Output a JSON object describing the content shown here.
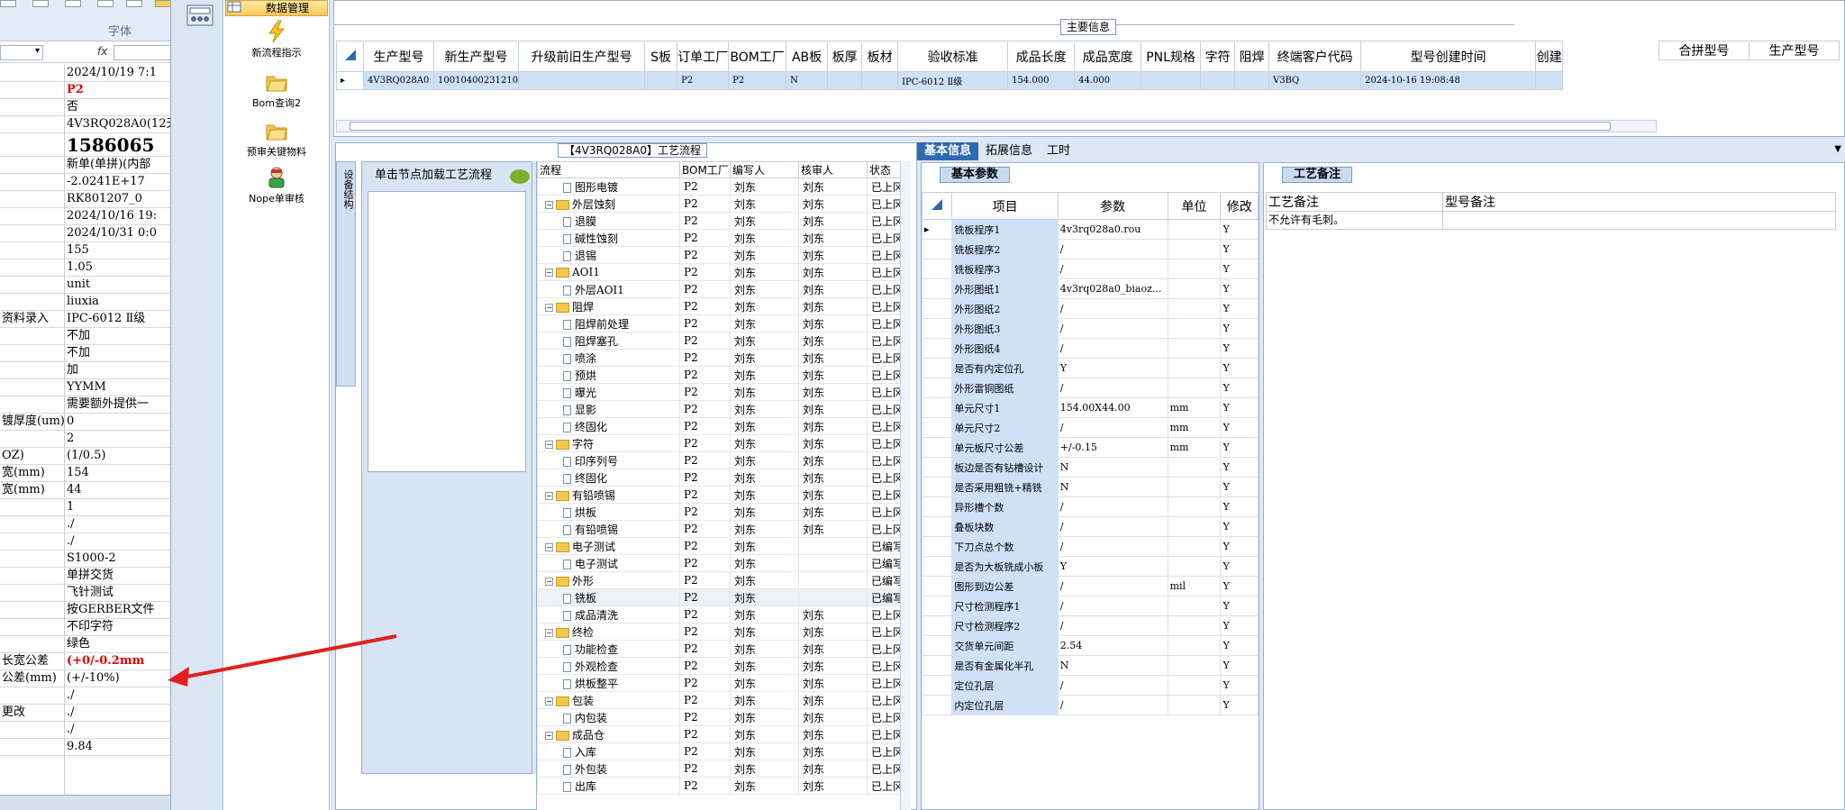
{
  "excel": {
    "ribbon_group": "字体",
    "formula_fx": "fx",
    "col_a": [
      "",
      "",
      "",
      "",
      "",
      "",
      "",
      "",
      "",
      "",
      "",
      "",
      "",
      "",
      "资料录入",
      "",
      "",
      "",
      "",
      "",
      "镀厚度(um)",
      "",
      "OZ)",
      "宽(mm)",
      "宽(mm)",
      "",
      "",
      "",
      "",
      "",
      "",
      "",
      "",
      "",
      "长宽公差",
      "公差(mm)",
      "",
      "更改",
      "",
      ""
    ],
    "col_b": [
      "2024/10/19 7:1",
      "P2",
      "否",
      "4V3RQ028A0(12天",
      "1586065",
      "新单(单拼)(内部",
      "-2.0241E+17",
      "RK801207_0",
      "2024/10/16 19:",
      "2024/10/31 0:0",
      "155",
      "1.05",
      "unit",
      "liuxia",
      "IPC-6012 Ⅱ级",
      "不加",
      "不加",
      "加",
      "YYMM",
      "需要额外提供一",
      "0",
      "2",
      "(1/0.5)",
      "154",
      "44",
      "1",
      "./",
      "./",
      "S1000-2",
      "单拼交货",
      "飞针测试",
      "按GERBER文件",
      "不印字符",
      "绿色",
      "(+0/-0.2mm",
      "(+/-10%)",
      "./",
      "./",
      "./",
      "9.84"
    ]
  },
  "nav": {
    "header": "数据管理",
    "items": [
      {
        "label": "新流程指示",
        "icon": "lightning-icon"
      },
      {
        "label": "Bom查询2",
        "icon": "folder-icon"
      },
      {
        "label": "预审关键物料",
        "icon": "folder-icon"
      },
      {
        "label": "Nope单审核",
        "icon": "user-icon"
      }
    ]
  },
  "main_info": {
    "caption": "主要信息",
    "columns": [
      "生产型号",
      "新生产型号",
      "升级前旧生产型号",
      "S板",
      "订单工厂",
      "BOM工厂",
      "AB板",
      "板厚",
      "板材",
      "验收标准",
      "成品长度",
      "成品宽度",
      "PNL规格",
      "字符",
      "阻焊",
      "终端客户代码",
      "型号创建时间",
      "创建"
    ],
    "row": [
      "4V3RQ028A0",
      "10010400231210",
      "",
      "",
      "P2",
      "P2",
      "N",
      "",
      "",
      "IPC-6012 Ⅱ级",
      "154.000",
      "44.000",
      "",
      "",
      "",
      "V3BQ",
      "2024-10-16 19:08:48",
      ""
    ],
    "right_columns": [
      "合拼型号",
      "生产型号"
    ]
  },
  "process": {
    "title": "【4V3RQ028A0】工艺流程",
    "side_tab": "设备结构",
    "click_label": "单击节点加载工艺流程",
    "columns": [
      "流程",
      "BOM工厂",
      "编写人",
      "核审人",
      "状态"
    ],
    "rows": [
      {
        "name": "图形电镀",
        "level": 1,
        "f": "P2",
        "w": "刘东",
        "r": "刘东",
        "s": "已上冈",
        "folder": false
      },
      {
        "name": "外层蚀刻",
        "level": 0,
        "f": "P2",
        "w": "刘东",
        "r": "刘东",
        "s": "已上冈",
        "folder": true
      },
      {
        "name": "退膜",
        "level": 1,
        "f": "P2",
        "w": "刘东",
        "r": "刘东",
        "s": "已上冈",
        "folder": false
      },
      {
        "name": "碱性蚀刻",
        "level": 1,
        "f": "P2",
        "w": "刘东",
        "r": "刘东",
        "s": "已上冈",
        "folder": false
      },
      {
        "name": "退锡",
        "level": 1,
        "f": "P2",
        "w": "刘东",
        "r": "刘东",
        "s": "已上冈",
        "folder": false
      },
      {
        "name": "AOI1",
        "level": 0,
        "f": "P2",
        "w": "刘东",
        "r": "刘东",
        "s": "已上冈",
        "folder": true
      },
      {
        "name": "外层AOI1",
        "level": 1,
        "f": "P2",
        "w": "刘东",
        "r": "刘东",
        "s": "已上冈",
        "folder": false
      },
      {
        "name": "阻焊",
        "level": 0,
        "f": "P2",
        "w": "刘东",
        "r": "刘东",
        "s": "已上冈",
        "folder": true
      },
      {
        "name": "阻焊前处理",
        "level": 1,
        "f": "P2",
        "w": "刘东",
        "r": "刘东",
        "s": "已上冈",
        "folder": false
      },
      {
        "name": "阻焊塞孔",
        "level": 1,
        "f": "P2",
        "w": "刘东",
        "r": "刘东",
        "s": "已上冈",
        "folder": false
      },
      {
        "name": "喷涂",
        "level": 1,
        "f": "P2",
        "w": "刘东",
        "r": "刘东",
        "s": "已上冈",
        "folder": false
      },
      {
        "name": "预烘",
        "level": 1,
        "f": "P2",
        "w": "刘东",
        "r": "刘东",
        "s": "已上冈",
        "folder": false
      },
      {
        "name": "曝光",
        "level": 1,
        "f": "P2",
        "w": "刘东",
        "r": "刘东",
        "s": "已上冈",
        "folder": false
      },
      {
        "name": "显影",
        "level": 1,
        "f": "P2",
        "w": "刘东",
        "r": "刘东",
        "s": "已上冈",
        "folder": false
      },
      {
        "name": "终固化",
        "level": 1,
        "f": "P2",
        "w": "刘东",
        "r": "刘东",
        "s": "已上冈",
        "folder": false
      },
      {
        "name": "字符",
        "level": 0,
        "f": "P2",
        "w": "刘东",
        "r": "刘东",
        "s": "已上冈",
        "folder": true
      },
      {
        "name": "印序列号",
        "level": 1,
        "f": "P2",
        "w": "刘东",
        "r": "刘东",
        "s": "已上冈",
        "folder": false
      },
      {
        "name": "终固化",
        "level": 1,
        "f": "P2",
        "w": "刘东",
        "r": "刘东",
        "s": "已上冈",
        "folder": false
      },
      {
        "name": "有铅喷锡",
        "level": 0,
        "f": "P2",
        "w": "刘东",
        "r": "刘东",
        "s": "已上冈",
        "folder": true
      },
      {
        "name": "烘板",
        "level": 1,
        "f": "P2",
        "w": "刘东",
        "r": "刘东",
        "s": "已上冈",
        "folder": false
      },
      {
        "name": "有铅喷锡",
        "level": 1,
        "f": "P2",
        "w": "刘东",
        "r": "刘东",
        "s": "已上冈",
        "folder": false
      },
      {
        "name": "电子测试",
        "level": 0,
        "f": "P2",
        "w": "刘东",
        "r": "",
        "s": "已编写",
        "folder": true
      },
      {
        "name": "电子测试",
        "level": 1,
        "f": "P2",
        "w": "刘东",
        "r": "",
        "s": "已编写",
        "folder": false
      },
      {
        "name": "外形",
        "level": 0,
        "f": "P2",
        "w": "刘东",
        "r": "",
        "s": "已编写",
        "folder": true
      },
      {
        "name": "铣板",
        "level": 1,
        "f": "P2",
        "w": "刘东",
        "r": "",
        "s": "已编写",
        "folder": false
      },
      {
        "name": "成品清洗",
        "level": 1,
        "f": "P2",
        "w": "刘东",
        "r": "刘东",
        "s": "已上冈",
        "folder": false
      },
      {
        "name": "终检",
        "level": 0,
        "f": "P2",
        "w": "刘东",
        "r": "刘东",
        "s": "已上冈",
        "folder": true
      },
      {
        "name": "功能检查",
        "level": 1,
        "f": "P2",
        "w": "刘东",
        "r": "刘东",
        "s": "已上冈",
        "folder": false
      },
      {
        "name": "外观检查",
        "level": 1,
        "f": "P2",
        "w": "刘东",
        "r": "刘东",
        "s": "已上冈",
        "folder": false
      },
      {
        "name": "烘板整平",
        "level": 1,
        "f": "P2",
        "w": "刘东",
        "r": "刘东",
        "s": "已上冈",
        "folder": false
      },
      {
        "name": "包装",
        "level": 0,
        "f": "P2",
        "w": "刘东",
        "r": "刘东",
        "s": "已上冈",
        "folder": true
      },
      {
        "name": "内包装",
        "level": 1,
        "f": "P2",
        "w": "刘东",
        "r": "刘东",
        "s": "已上冈",
        "folder": false
      },
      {
        "name": "成品仓",
        "level": 0,
        "f": "P2",
        "w": "刘东",
        "r": "刘东",
        "s": "已上冈",
        "folder": true
      },
      {
        "name": "入库",
        "level": 1,
        "f": "P2",
        "w": "刘东",
        "r": "刘东",
        "s": "已上冈",
        "folder": false
      },
      {
        "name": "外包装",
        "level": 1,
        "f": "P2",
        "w": "刘东",
        "r": "刘东",
        "s": "已上冈",
        "folder": false
      },
      {
        "name": "出库",
        "level": 1,
        "f": "P2",
        "w": "刘东",
        "r": "刘东",
        "s": "已上冈",
        "folder": false
      }
    ]
  },
  "basic": {
    "tabs": [
      "基本信息",
      "拓展信息",
      "工时"
    ],
    "subtab": "基本参数",
    "columns": [
      "项目",
      "参数",
      "单位",
      "修改"
    ],
    "rows": [
      {
        "item": "铣板程序1",
        "param": "4v3rq028a0.rou",
        "unit": "",
        "mod": "Y"
      },
      {
        "item": "铣板程序2",
        "param": "/",
        "unit": "",
        "mod": "Y"
      },
      {
        "item": "铣板程序3",
        "param": "/",
        "unit": "",
        "mod": "Y"
      },
      {
        "item": "外形图纸1",
        "param": "4v3rq028a0_biaoz...",
        "unit": "",
        "mod": "Y"
      },
      {
        "item": "外形图纸2",
        "param": "/",
        "unit": "",
        "mod": "Y"
      },
      {
        "item": "外形图纸3",
        "param": "/",
        "unit": "",
        "mod": "Y"
      },
      {
        "item": "外形图纸4",
        "param": "/",
        "unit": "",
        "mod": "Y"
      },
      {
        "item": "是否有内定位孔",
        "param": "Y",
        "unit": "",
        "mod": "Y"
      },
      {
        "item": "外形雷铜图纸",
        "param": "/",
        "unit": "",
        "mod": "Y"
      },
      {
        "item": "单元尺寸1",
        "param": "154.00X44.00",
        "unit": "mm",
        "mod": "Y"
      },
      {
        "item": "单元尺寸2",
        "param": "/",
        "unit": "mm",
        "mod": "Y"
      },
      {
        "item": "单元板尺寸公差",
        "param": "+/-0.15",
        "unit": "mm",
        "mod": "Y"
      },
      {
        "item": "板边是否有钻槽设计",
        "param": "N",
        "unit": "",
        "mod": "Y"
      },
      {
        "item": "是否采用粗铣+精铣",
        "param": "N",
        "unit": "",
        "mod": "Y"
      },
      {
        "item": "异形槽个数",
        "param": "/",
        "unit": "",
        "mod": "Y"
      },
      {
        "item": "叠板块数",
        "param": "/",
        "unit": "",
        "mod": "Y"
      },
      {
        "item": "下刀点总个数",
        "param": "/",
        "unit": "",
        "mod": "Y"
      },
      {
        "item": "是否为大板铣成小板",
        "param": "Y",
        "unit": "",
        "mod": "Y"
      },
      {
        "item": "图形到边公差",
        "param": "/",
        "unit": "mil",
        "mod": "Y"
      },
      {
        "item": "尺寸检测程序1",
        "param": "/",
        "unit": "",
        "mod": "Y"
      },
      {
        "item": "尺寸检测程序2",
        "param": "/",
        "unit": "",
        "mod": "Y"
      },
      {
        "item": "交货单元间距",
        "param": "2.54",
        "unit": "",
        "mod": "Y"
      },
      {
        "item": "是否有金属化半孔",
        "param": "N",
        "unit": "",
        "mod": "Y"
      },
      {
        "item": "定位孔层",
        "param": "/",
        "unit": "",
        "mod": "Y"
      },
      {
        "item": "内定位孔层",
        "param": "/",
        "unit": "",
        "mod": "Y"
      }
    ]
  },
  "notes": {
    "subtab": "工艺备注",
    "columns": [
      "工艺备注",
      "型号备注"
    ],
    "process_note": "不允许有毛刺。",
    "model_note": ""
  },
  "colors": {
    "selected_row": "#cfe1f7",
    "tab_active": "#2e6ab3",
    "arrow": "#e02020",
    "excel_red": "#dd0000"
  }
}
